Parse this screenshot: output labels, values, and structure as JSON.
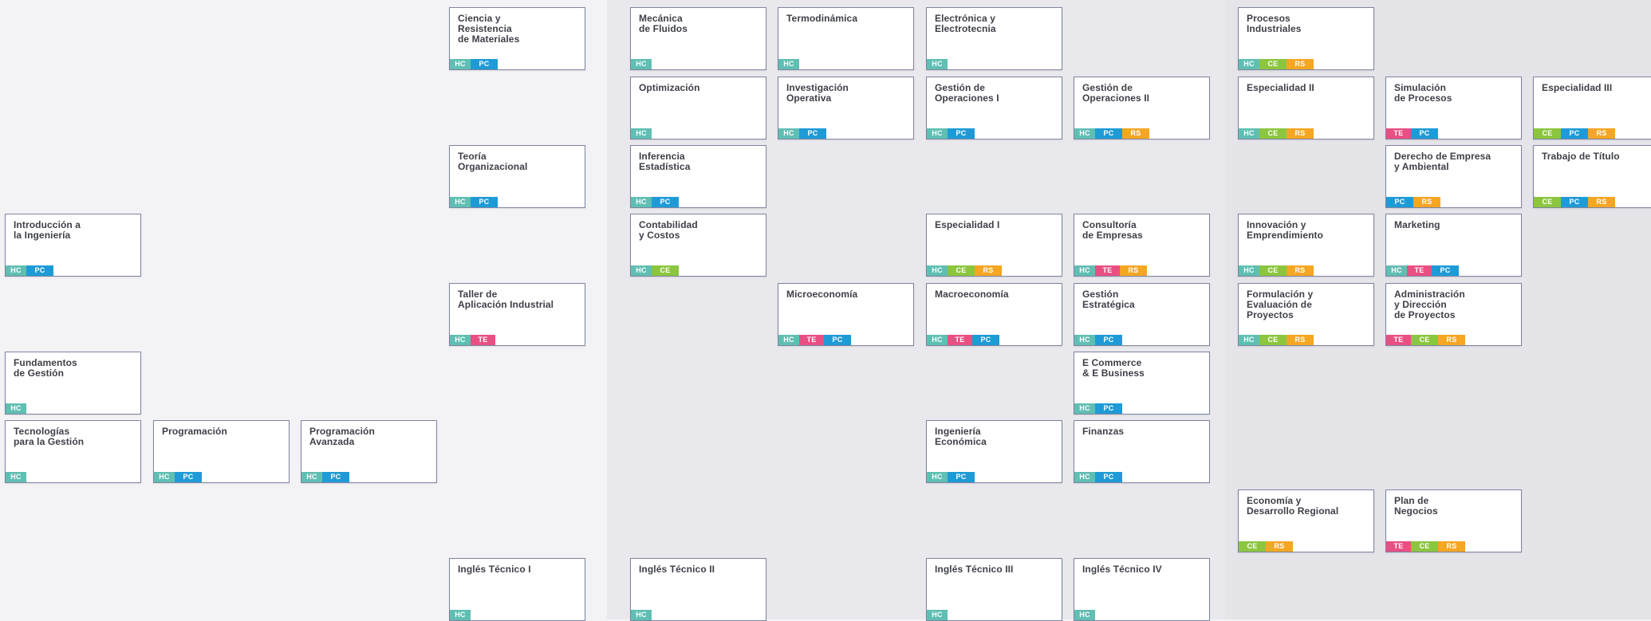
{
  "colors": {
    "HC": "#5fbfb3",
    "PC": "#1e9bd7",
    "CE": "#8cc63f",
    "RS": "#f5a623",
    "TE": "#e94f83",
    "card_border": "#7e84a3",
    "title_text": "#3e4048"
  },
  "courses": [
    {
      "id": "ciencia-y-resistencia-de-materiales",
      "title": "Ciencia y\nResistencia\nde Materiales",
      "tags": [
        "HC",
        "PC"
      ]
    },
    {
      "id": "mecanica-de-fluidos",
      "title": "Mecánica\nde Fluidos",
      "tags": [
        "HC"
      ]
    },
    {
      "id": "termodinamica",
      "title": "Termodinámica",
      "tags": [
        "HC"
      ]
    },
    {
      "id": "electronica-y-electrotecnia",
      "title": "Electrónica y\nElectrotecnia",
      "tags": [
        "HC"
      ]
    },
    {
      "id": "procesos-industriales",
      "title": "Procesos\nIndustriales",
      "tags": [
        "HC",
        "CE",
        "RS"
      ]
    },
    {
      "id": "optimizacion",
      "title": "Optimización",
      "tags": [
        "HC"
      ]
    },
    {
      "id": "investigacion-operativa",
      "title": "Investigación\nOperativa",
      "tags": [
        "HC",
        "PC"
      ]
    },
    {
      "id": "gestion-de-operaciones-i",
      "title": "Gestión de\nOperaciones I",
      "tags": [
        "HC",
        "PC"
      ]
    },
    {
      "id": "gestion-de-operaciones-ii",
      "title": "Gestión de\nOperaciones II",
      "tags": [
        "HC",
        "PC",
        "RS"
      ]
    },
    {
      "id": "especialidad-ii",
      "title": "Especialidad II",
      "tags": [
        "HC",
        "CE",
        "RS"
      ]
    },
    {
      "id": "simulacion-de-procesos",
      "title": "Simulación\nde Procesos",
      "tags": [
        "TE",
        "PC"
      ]
    },
    {
      "id": "especialidad-iii",
      "title": "Especialidad III",
      "tags": [
        "CE",
        "PC",
        "RS"
      ]
    },
    {
      "id": "teoria-organizacional",
      "title": "Teoría\nOrganizacional",
      "tags": [
        "HC",
        "PC"
      ]
    },
    {
      "id": "inferencia-estadistica",
      "title": "Inferencia\nEstadística",
      "tags": [
        "HC",
        "PC"
      ]
    },
    {
      "id": "derecho-de-empresa-y-ambiental",
      "title": "Derecho de Empresa\ny Ambiental",
      "tags": [
        "PC",
        "RS"
      ]
    },
    {
      "id": "trabajo-de-titulo",
      "title": "Trabajo de Título",
      "tags": [
        "CE",
        "PC",
        "RS"
      ]
    },
    {
      "id": "introduccion-a-la-ingenieria",
      "title": "Introducción a\nla Ingeniería",
      "tags": [
        "HC",
        "PC"
      ]
    },
    {
      "id": "contabilidad-y-costos",
      "title": "Contabilidad\ny Costos",
      "tags": [
        "HC",
        "CE"
      ]
    },
    {
      "id": "especialidad-i",
      "title": "Especialidad I",
      "tags": [
        "HC",
        "CE",
        "RS"
      ]
    },
    {
      "id": "consultoria-de-empresas",
      "title": "Consultoría\nde Empresas",
      "tags": [
        "HC",
        "TE",
        "RS"
      ]
    },
    {
      "id": "innovacion-y-emprendimiento",
      "title": "Innovación y\nEmprendimiento",
      "tags": [
        "HC",
        "CE",
        "RS"
      ]
    },
    {
      "id": "marketing",
      "title": "Marketing",
      "tags": [
        "HC",
        "TE",
        "PC"
      ]
    },
    {
      "id": "taller-de-aplicacion-industrial",
      "title": "Taller de\nAplicación Industrial",
      "tags": [
        "HC",
        "TE"
      ]
    },
    {
      "id": "microeconomia",
      "title": "Microeconomía",
      "tags": [
        "HC",
        "TE",
        "PC"
      ]
    },
    {
      "id": "macroeconomia",
      "title": "Macroeconomía",
      "tags": [
        "HC",
        "TE",
        "PC"
      ]
    },
    {
      "id": "gestion-estrategica",
      "title": "Gestión\nEstratégica",
      "tags": [
        "HC",
        "PC"
      ]
    },
    {
      "id": "formulacion-y-evaluacion-de-proyectos",
      "title": "Formulación y\nEvaluación de\nProyectos",
      "tags": [
        "HC",
        "CE",
        "RS"
      ]
    },
    {
      "id": "administracion-y-direccion-de-proyectos",
      "title": "Administración\ny Dirección\nde Proyectos",
      "tags": [
        "TE",
        "CE",
        "RS"
      ]
    },
    {
      "id": "fundamentos-de-gestion",
      "title": "Fundamentos\nde Gestión",
      "tags": [
        "HC"
      ]
    },
    {
      "id": "e-commerce-e-business",
      "title": "E Commerce\n& E Business",
      "tags": [
        "HC",
        "PC"
      ]
    },
    {
      "id": "tecnologias-para-la-gestion",
      "title": "Tecnologías\npara la Gestión",
      "tags": [
        "HC"
      ]
    },
    {
      "id": "programacion",
      "title": "Programación",
      "tags": [
        "HC",
        "PC"
      ]
    },
    {
      "id": "programacion-avanzada",
      "title": "Programación\nAvanzada",
      "tags": [
        "HC",
        "PC"
      ]
    },
    {
      "id": "ingenieria-economica",
      "title": "Ingeniería\nEconómica",
      "tags": [
        "HC",
        "PC"
      ]
    },
    {
      "id": "finanzas",
      "title": "Finanzas",
      "tags": [
        "HC",
        "PC"
      ]
    },
    {
      "id": "economia-y-desarrollo-regional",
      "title": "Economía y\nDesarrollo Regional",
      "tags": [
        "CE",
        "RS"
      ]
    },
    {
      "id": "plan-de-negocios",
      "title": "Plan de\nNegocios",
      "tags": [
        "TE",
        "CE",
        "RS"
      ]
    },
    {
      "id": "ingles-tecnico-i",
      "title": "Inglés Técnico I",
      "tags": [
        "HC"
      ]
    },
    {
      "id": "ingles-tecnico-ii",
      "title": "Inglés Técnico II",
      "tags": [
        "HC"
      ]
    },
    {
      "id": "ingles-tecnico-iii",
      "title": "Inglés Técnico III",
      "tags": [
        "HC"
      ]
    },
    {
      "id": "ingles-tecnico-iv",
      "title": "Inglés Técnico IV",
      "tags": [
        "HC"
      ]
    }
  ]
}
